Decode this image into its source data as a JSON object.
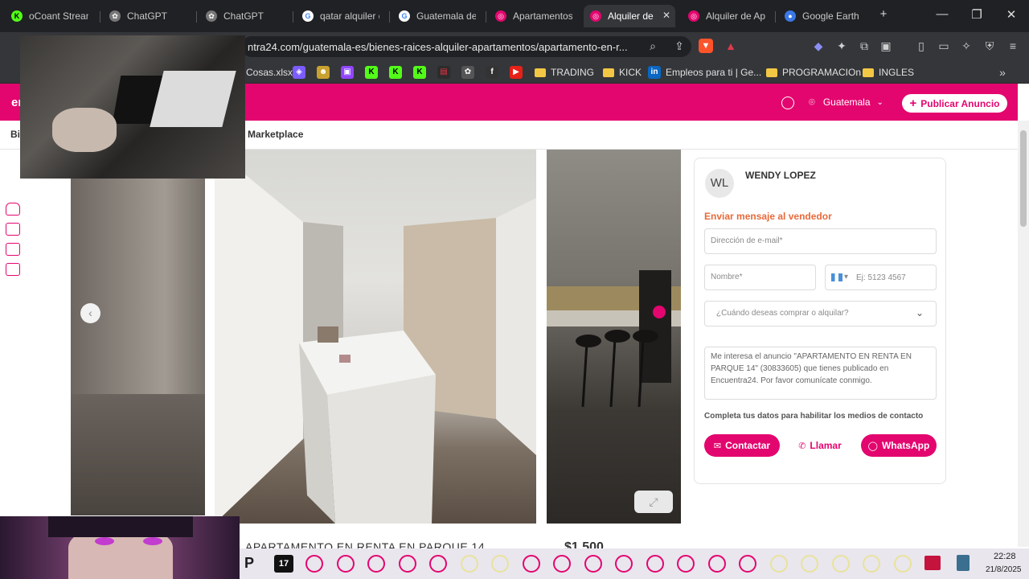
{
  "browser": {
    "tabs": [
      {
        "label": "oCoant Stream",
        "favicon": "kick-icon",
        "color": "#53fc18"
      },
      {
        "label": "ChatGPT",
        "favicon": "chatgpt-icon",
        "color": "#777777"
      },
      {
        "label": "ChatGPT",
        "favicon": "chatgpt-icon",
        "color": "#777777"
      },
      {
        "label": "qatar alquiler d",
        "favicon": "google-icon",
        "color": "#4285f4"
      },
      {
        "label": "Guatemala de",
        "favicon": "google-icon",
        "color": "#4285f4"
      },
      {
        "label": "Apartamentos",
        "favicon": "encuentra24-icon",
        "color": "#e3066f"
      },
      {
        "label": "Alquiler de",
        "favicon": "encuentra24-icon",
        "color": "#e3066f",
        "active": true
      },
      {
        "label": "Alquiler de Ap",
        "favicon": "encuentra24-icon",
        "color": "#e3066f"
      },
      {
        "label": "Google Earth",
        "favicon": "google-earth-icon",
        "color": "#3b78e7"
      }
    ],
    "url": "ntra24.com/guatemala-es/bienes-raices-alquiler-apartamentos/apartamento-en-r...",
    "bookmarks": [
      {
        "label": "Cosas.xlsx",
        "type": "file"
      },
      {
        "label": "TRADING",
        "type": "folder"
      },
      {
        "label": "KICK",
        "type": "folder"
      },
      {
        "label": "Empleos para ti | Ge...",
        "type": "link"
      },
      {
        "label": "PROGRAMACIOn",
        "type": "folder"
      },
      {
        "label": "INGLES",
        "type": "folder"
      }
    ]
  },
  "site": {
    "logo_fragment": "en",
    "country": "Guatemala",
    "publish_label": "Publicar Anuncio",
    "nav_fragment": "Bi",
    "nav_marketplace": "Marketplace",
    "brand_color": "#e3066f"
  },
  "contact": {
    "avatar_initials": "WL",
    "seller_name": "WENDY LOPEZ",
    "send_title": "Enviar mensaje al vendedor",
    "email_placeholder": "Dirección de e-mail*",
    "name_placeholder": "Nombre*",
    "phone_prefix": "▾",
    "phone_placeholder": "Ej: 5123 4567",
    "when_placeholder": "¿Cuándo deseas comprar o alquilar?",
    "message": "Me interesa el anuncio \"APARTAMENTO EN RENTA EN PARQUE 14\" (30833605) que tienes publicado en Encuentra24. Por favor comunícate conmigo.",
    "helper": "Completa tus datos para habilitar los medios de contacto",
    "btn_contact": "Contactar",
    "btn_call": "Llamar",
    "btn_whatsapp": "WhatsApp"
  },
  "listing": {
    "title_partial": "APARTAMENTO EN RENTA EN PARQUE 14",
    "price_partial": "$1,500"
  },
  "taskbar": {
    "time": "22:28",
    "date": "21/8/2025",
    "tv_label": "17"
  }
}
